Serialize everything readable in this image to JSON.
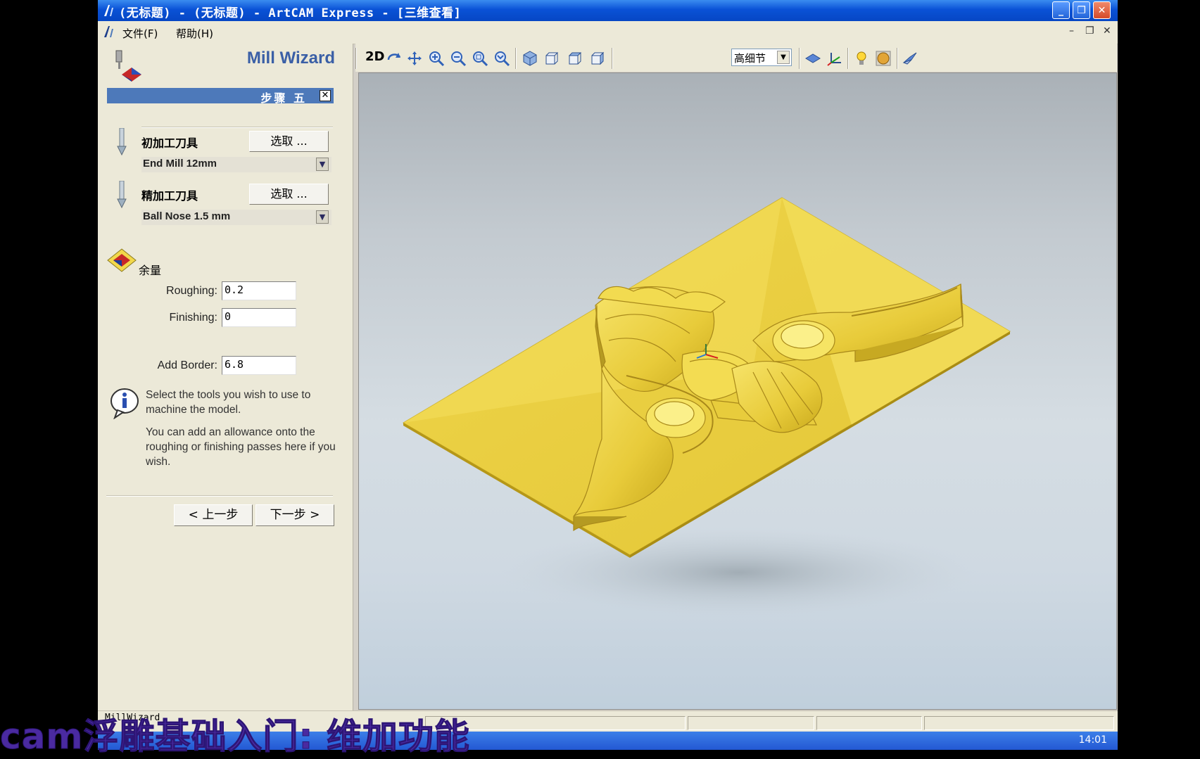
{
  "window": {
    "title": "(无标题) - (无标题) - ArtCAM Express - [三维查看]",
    "minimize": "_",
    "maximize": "❐",
    "close": "✕"
  },
  "menu": {
    "items": [
      "文件(F)",
      "帮助(H)"
    ],
    "mdi_min": "–",
    "mdi_restore": "❐",
    "mdi_close": "✕"
  },
  "wizard": {
    "title": "Mill Wizard",
    "step": "步骤 五",
    "step_close": "✕",
    "rough_tool_label": "初加工刀具",
    "rough_select": "选取 ...",
    "rough_tool_value": "End Mill 12mm",
    "finish_tool_label": "精加工刀具",
    "finish_select": "选取 ...",
    "finish_tool_value": "Ball Nose 1.5 mm",
    "dropdown_arrow": "▼",
    "allowance_label": "余量",
    "roughing_label": "Roughing:",
    "roughing_value": "0.2",
    "finishing_label": "Finishing:",
    "finishing_value": "0",
    "border_label": "Add Border:",
    "border_value": "6.8",
    "info1": "Select the tools you wish to use to machine the model.",
    "info2": "You can add an allowance onto the roughing or finishing passes here if you wish.",
    "back": "< 上一步",
    "next": "下一步 >"
  },
  "toolbar": {
    "mode_2d": "2D",
    "detail": "高细节",
    "detail_arrow": "▼"
  },
  "status": {
    "panel_label": "MillWizard",
    "clock": "14:01"
  },
  "caption": "cam浮雕基础入门: 维加功能",
  "colors": {
    "model": "#f0d84a",
    "titlebar": "#0a52d6",
    "accent": "#4d79ba"
  }
}
